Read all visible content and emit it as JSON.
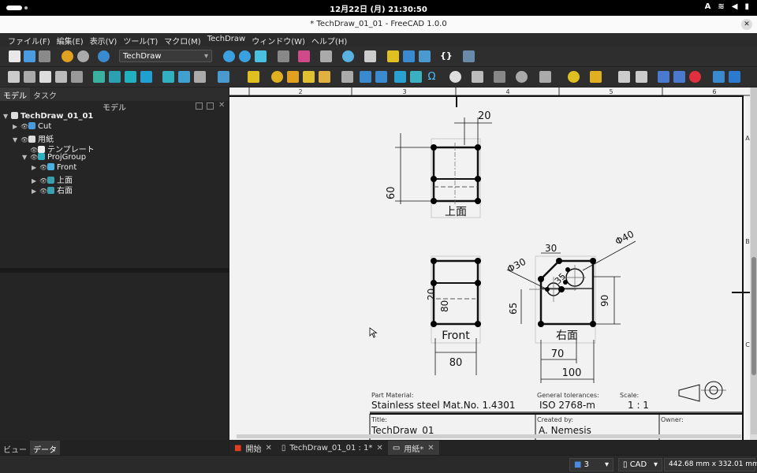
{
  "system": {
    "clock": "12月22日 (月)  21:30:50",
    "input_method": "A"
  },
  "window": {
    "title": "* TechDraw_01_01 - FreeCAD 1.0.0"
  },
  "menu": [
    "ファイル(F)",
    "編集(E)",
    "表示(V)",
    "ツール(T)",
    "マクロ(M)",
    "TechDraw",
    "ウィンドウ(W)",
    "ヘルプ(H)"
  ],
  "toolbar": {
    "workbench": "TechDraw",
    "macro_braces": "{}"
  },
  "left_panel": {
    "tabs": [
      "モデル",
      "タスク"
    ],
    "header": "モデル",
    "tree": [
      {
        "label": "TechDraw_01_01",
        "bold": true
      },
      {
        "label": "Cut"
      },
      {
        "label": "用紙"
      },
      {
        "label": "テンプレート"
      },
      {
        "label": "ProjGroup"
      },
      {
        "label": "Front"
      },
      {
        "label": "上面"
      },
      {
        "label": "右面"
      }
    ],
    "bottom_tabs": [
      "ビュー",
      "データ"
    ]
  },
  "drawing": {
    "col_labels": [
      "2",
      "3",
      "4",
      "5",
      "6"
    ],
    "row_labels": [
      "A",
      "B",
      "C"
    ],
    "views": {
      "top": "上面",
      "front": "Front",
      "right": "右面"
    },
    "dims": {
      "top_width": "20",
      "top_height": "60",
      "front_width": "80",
      "front_height": "80",
      "front_inner": "20",
      "right_30": "30",
      "right_phi40": "Φ40",
      "right_phi30": "Φ30",
      "right_35": "35",
      "right_65": "65",
      "right_90": "90",
      "right_70": "70",
      "right_100": "100"
    },
    "titleblock": {
      "material_label": "Part Material:",
      "material": "Stainless steel  Mat.No. 1.4301",
      "tol_label": "General tolerances:",
      "tolerance": "ISO 2768-m",
      "scale_label": "Scale:",
      "scale": "1 : 1",
      "title_label": "Title:",
      "title": "TechDraw_01",
      "created_label": "Created by:",
      "created": "A. Nemesis",
      "owner_label": "Owner:"
    }
  },
  "view_tabs": [
    "開始",
    "TechDraw_01_01 : 1*",
    "用紙*"
  ],
  "status": {
    "page": "3",
    "nav": "CAD",
    "dimensions": "442.68 mm x 332.01 mm"
  }
}
